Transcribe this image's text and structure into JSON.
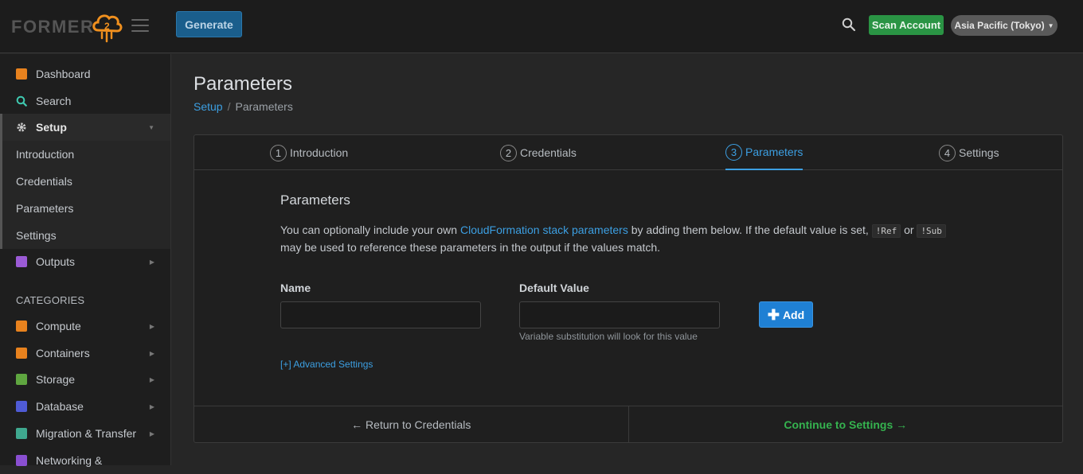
{
  "header": {
    "logo_text": "FORMER",
    "logo_badge": "2",
    "generate_label": "Generate",
    "scan_label": "Scan Account",
    "region_label": "Asia Pacific (Tokyo)",
    "colors": {
      "topbar": "#1c1c1c",
      "accent": "#f0901e",
      "generate": "#1a5e8c",
      "scan": "#2a9444"
    }
  },
  "sidebar": {
    "items": [
      {
        "label": "Dashboard",
        "icon": "dashboard-icon",
        "color": "#e8821e"
      },
      {
        "label": "Search",
        "icon": "search-icon",
        "color": "#3fc9b0"
      },
      {
        "label": "Setup",
        "icon": "gear-icon",
        "color": "#bbbbbb"
      },
      {
        "label": "Outputs",
        "icon": "outputs-icon",
        "color": "#9b5bd6"
      }
    ],
    "setup_sub": [
      "Introduction",
      "Credentials",
      "Parameters",
      "Settings"
    ],
    "categories_label": "CATEGORIES",
    "categories": [
      {
        "label": "Compute",
        "icon": "compute-icon",
        "color": "#e8821e"
      },
      {
        "label": "Containers",
        "icon": "containers-icon",
        "color": "#e8821e"
      },
      {
        "label": "Storage",
        "icon": "storage-icon",
        "color": "#5fa640"
      },
      {
        "label": "Database",
        "icon": "database-icon",
        "color": "#4f5bd5"
      },
      {
        "label": "Migration & Transfer",
        "icon": "migration-icon",
        "color": "#3fa88f"
      },
      {
        "label": "Networking &",
        "icon": "networking-icon",
        "color": "#8a4fd1"
      }
    ]
  },
  "main": {
    "title": "Parameters",
    "breadcrumb": {
      "root": "Setup",
      "current": "Parameters"
    },
    "steps": [
      {
        "num": "1",
        "label": "Introduction"
      },
      {
        "num": "2",
        "label": "Credentials"
      },
      {
        "num": "3",
        "label": "Parameters"
      },
      {
        "num": "4",
        "label": "Settings"
      }
    ],
    "form": {
      "heading": "Parameters",
      "desc_pre": "You can optionally include your own ",
      "desc_link": "CloudFormation stack parameters",
      "desc_mid": " by adding them below. If the default value is set, ",
      "code_ref": "!Ref",
      "desc_or": " or ",
      "code_sub": "!Sub",
      "desc_post": "may be used to reference these parameters in the output if the values match.",
      "name_label": "Name",
      "name_value": "",
      "default_label": "Default Value",
      "default_value": "",
      "default_help": "Variable substitution will look for this value",
      "add_label": "Add",
      "advanced_label": "[+] Advanced Settings"
    },
    "footer": {
      "back_label": "← Return to Credentials",
      "next_label": "Continue to Settings →"
    }
  }
}
